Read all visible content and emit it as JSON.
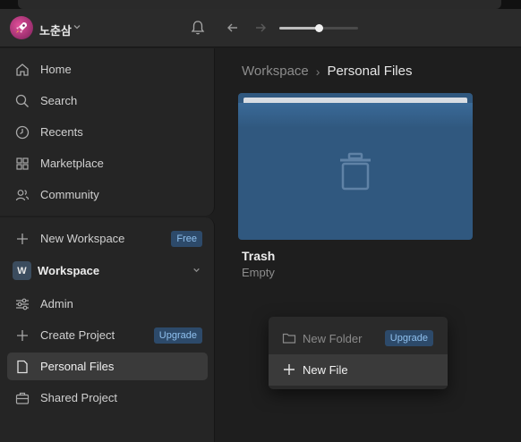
{
  "header": {
    "username": "노춘삼",
    "zoom_level": 0.5
  },
  "sidebar": {
    "nav": [
      {
        "label": "Home",
        "icon": "home-icon"
      },
      {
        "label": "Search",
        "icon": "search-icon"
      },
      {
        "label": "Recents",
        "icon": "clock-icon"
      },
      {
        "label": "Marketplace",
        "icon": "grid-icon"
      },
      {
        "label": "Community",
        "icon": "users-icon"
      }
    ],
    "new_workspace": {
      "label": "New Workspace",
      "badge": "Free"
    },
    "workspace": {
      "initial": "W",
      "label": "Workspace"
    },
    "items": [
      {
        "label": "Admin",
        "icon": "sliders-icon"
      },
      {
        "label": "Create Project",
        "icon": "plus-icon",
        "badge": "Upgrade"
      },
      {
        "label": "Personal Files",
        "icon": "file-icon",
        "active": true
      },
      {
        "label": "Shared Project",
        "icon": "briefcase-icon"
      }
    ]
  },
  "breadcrumb": {
    "root": "Workspace",
    "separator": "›",
    "current": "Personal Files"
  },
  "card": {
    "title": "Trash",
    "subtitle": "Empty"
  },
  "menu": {
    "new_folder": {
      "label": "New Folder",
      "badge": "Upgrade"
    },
    "new_file": {
      "label": "New File"
    }
  },
  "colors": {
    "accent_badge_bg": "#2d4a6a",
    "accent_badge_text": "#8fc0ee",
    "card": "#30587f"
  }
}
